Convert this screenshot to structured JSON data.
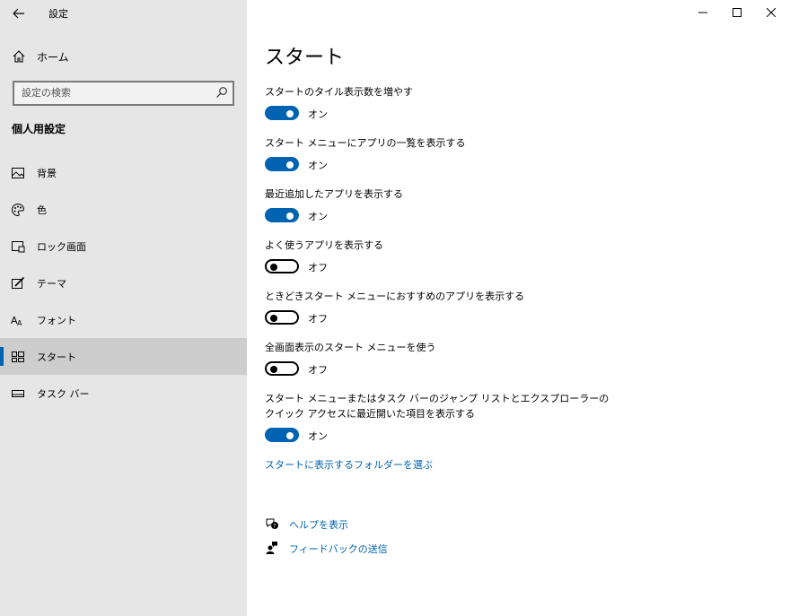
{
  "window": {
    "title": "設定",
    "controls": [
      "minimize-icon",
      "maximize-icon",
      "close-icon"
    ]
  },
  "sidebar": {
    "home_label": "ホーム",
    "search_placeholder": "設定の検索",
    "section_title": "個人用設定",
    "items": [
      {
        "label": "背景",
        "icon": "picture-icon",
        "active": false
      },
      {
        "label": "色",
        "icon": "palette-icon",
        "active": false
      },
      {
        "label": "ロック画面",
        "icon": "lock-screen-icon",
        "active": false
      },
      {
        "label": "テーマ",
        "icon": "theme-brush-icon",
        "active": false
      },
      {
        "label": "フォント",
        "icon": "font-icon",
        "active": false
      },
      {
        "label": "スタート",
        "icon": "start-tiles-icon",
        "active": true
      },
      {
        "label": "タスク バー",
        "icon": "taskbar-icon",
        "active": false
      }
    ]
  },
  "main": {
    "title": "スタート",
    "settings": [
      {
        "label": "スタートのタイル表示数を増やす",
        "on": true,
        "state": "オン"
      },
      {
        "label": "スタート メニューにアプリの一覧を表示する",
        "on": true,
        "state": "オン"
      },
      {
        "label": "最近追加したアプリを表示する",
        "on": true,
        "state": "オン"
      },
      {
        "label": "よく使うアプリを表示する",
        "on": false,
        "state": "オフ"
      },
      {
        "label": "ときどきスタート メニューにおすすめのアプリを表示する",
        "on": false,
        "state": "オフ"
      },
      {
        "label": "全画面表示のスタート メニューを使う",
        "on": false,
        "state": "オフ"
      },
      {
        "label": "スタート メニューまたはタスク バーのジャンプ リストとエクスプローラーのクイック アクセスに最近開いた項目を表示する",
        "on": true,
        "state": "オン"
      }
    ],
    "folder_link": "スタートに表示するフォルダーを選ぶ",
    "help_link": "ヘルプを表示",
    "feedback_link": "フィードバックの送信"
  },
  "colors": {
    "accent": "#0063b1",
    "sidebar_bg": "#e6e6e6",
    "selected_bg": "#cdcdcd"
  }
}
